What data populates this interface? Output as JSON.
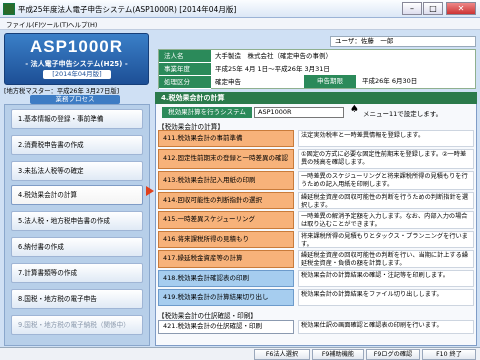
{
  "window": {
    "title": "平成25年度法人電子申告システム(ASP1000R) [2014年04月版]"
  },
  "menu": [
    "ファイル(F)",
    "ツール(T)",
    "ヘルプ(H)"
  ],
  "logo": {
    "name": "ASP1000R",
    "sub": "- 法人電子申告システム(H25) -",
    "version": "[2014年04月版]"
  },
  "tax_master": "[地方税マスター：平成26年 3月27日版]",
  "process_label": "業務プロセス",
  "steps": [
    "1.基本情報の登録・事前準備",
    "2.消費税申告書の作成",
    "3.未払法人税等の確定",
    "4.税効果会計の計算",
    "5.法人税・地方税申告書の作成",
    "6.納付書の作成",
    "7.計算書類等の作成",
    "8.国税・地方税の電子申告",
    "9.国税・地方税の電子納税（関係中）"
  ],
  "user": "ユーザ：佐藤　一郎",
  "info": {
    "corp_label": "法人名",
    "corp": "大手製造　株式会社（確定申告の事例）",
    "year_label": "事業年度",
    "year": "平成25年 4月 1日～平成26年 3月31日",
    "type_label": "処理区分",
    "type": "確定申告",
    "due_label": "申告期限",
    "due": "平成26年 6月30日"
  },
  "panel": {
    "title": "4.税効果会計の計算",
    "sys_label": "税効果計算を行うシステム",
    "sys_value": "ASP1000R",
    "sys_note": "メニュー11で設定します。",
    "sec1": "【税効果会計の計算】",
    "sec2": "【税効果会計の仕訳確認・印刷】",
    "items": [
      {
        "label": "411.税効果会計の事前準備",
        "desc": "法定実効税率と一時差異情報を登録します。"
      },
      {
        "label": "412.固定性前期末の登録と一時差異の確認",
        "desc": "①固定の方式に必要な固定性前期末を登録します。②一時差異の残高を確認します。"
      },
      {
        "label": "413.税効果会計記入用紙の印刷",
        "desc": "一時差異のスケジューリングと将来課税所得の見積もりを行うための記入用紙を印刷します。"
      },
      {
        "label": "414.回収可能性の判断指針の選択",
        "desc": "繰延税金資産の回収可能性の判断を行うための判断指針を選択します。"
      },
      {
        "label": "415.一時差異スケジューリング",
        "desc": "一時差異の解消予定額を入力します。なお、内部入力の場合は取り込むことができます。"
      },
      {
        "label": "416.将来課税所得の見積もり",
        "desc": "将来課税所得の見積もりとタックス・プランニングを行います。"
      },
      {
        "label": "417.繰延税金資産等の計算",
        "desc": "繰延税金資産の回収可能性の判断を行い、当期に計上する繰延税金資産・負債の額を計算します。"
      },
      {
        "label": "418.税効果会計確認表の印刷",
        "desc": "税効果会計の計算結果の確認・注記等を印刷します。"
      },
      {
        "label": "419.税効果会計の計算結果切り出し",
        "desc": "税効果会計の計算結果をファイル切り出しします。"
      },
      {
        "label": "421.税効果会計の仕訳確認・印刷",
        "desc": "税効果仕訳の画面確認と確認表の印刷を行います。"
      }
    ]
  },
  "footer": [
    "F6法人選択",
    "F9補助機能",
    "F9ログの確認",
    "F10 終了"
  ]
}
